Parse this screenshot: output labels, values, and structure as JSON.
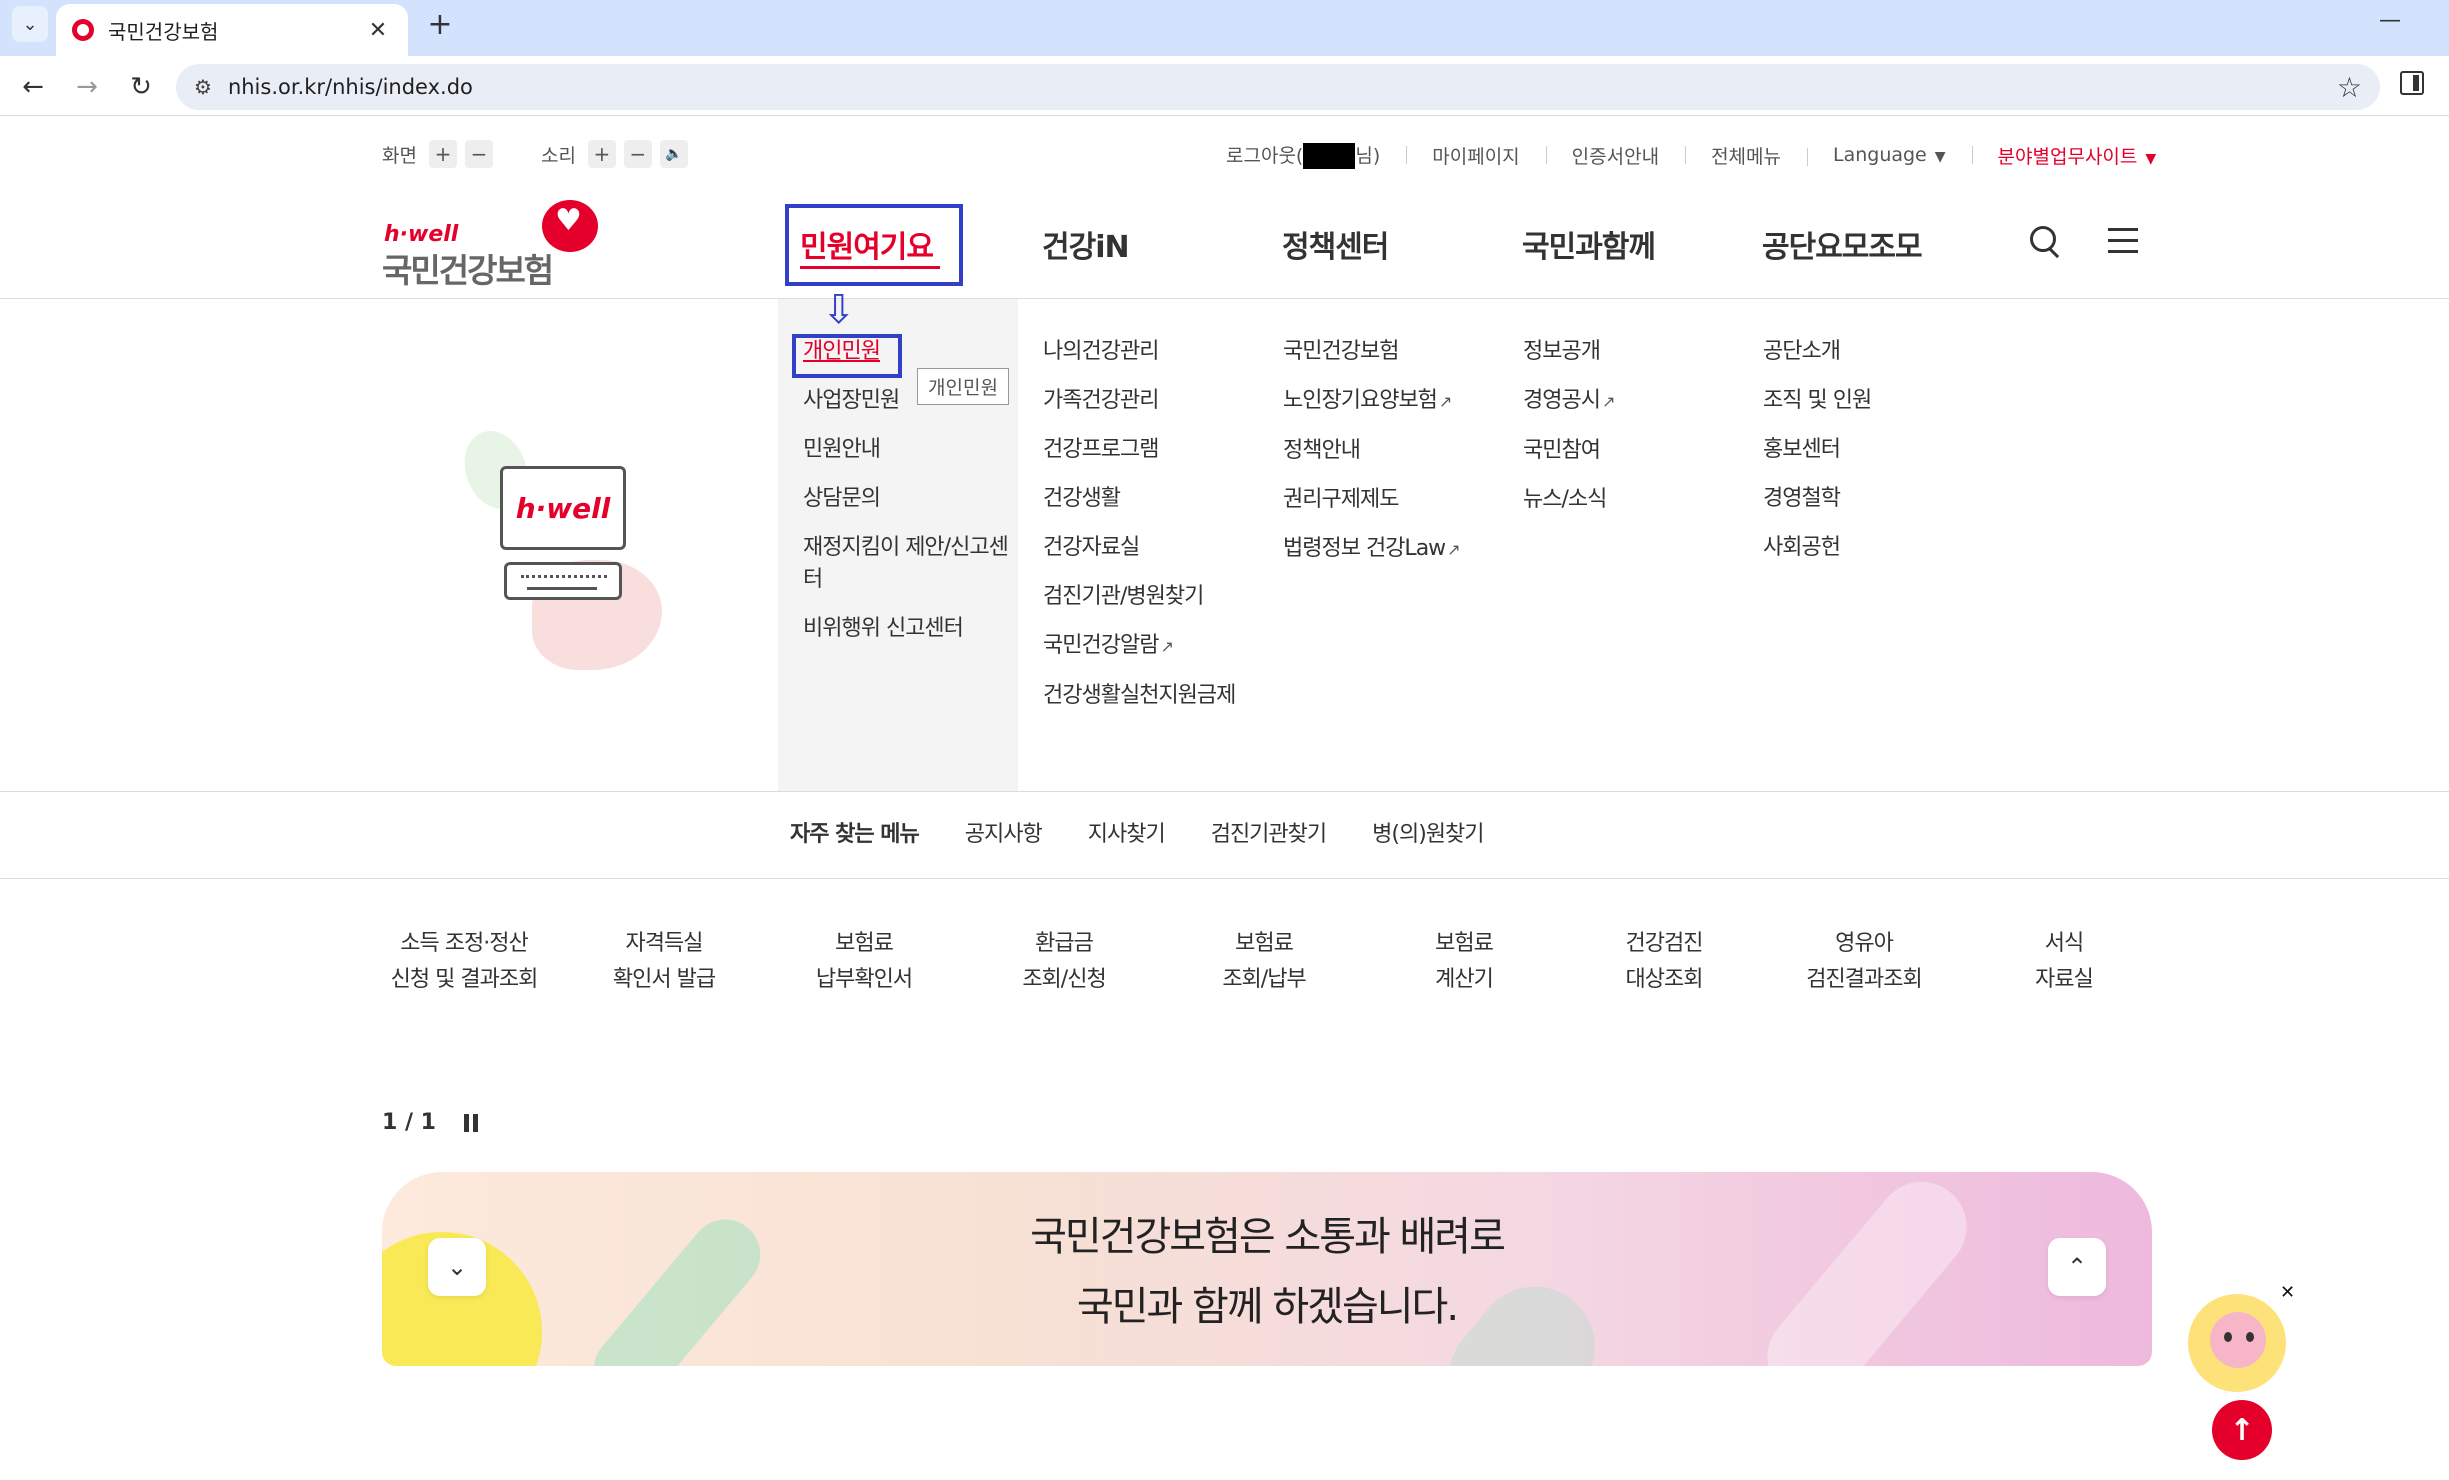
{
  "browser": {
    "tab_title": "국민건강보험",
    "url": "nhis.or.kr/nhis/index.do",
    "new_tab": "+",
    "close": "✕",
    "minimize": "—"
  },
  "util": {
    "screen_label": "화면",
    "sound_label": "소리",
    "plus": "+",
    "minus": "−",
    "speaker": "🔈",
    "logout_prefix": "로그아웃(",
    "logout_suffix": "님)",
    "mypage": "마이페이지",
    "cert": "인증서안내",
    "allmenu": "전체메뉴",
    "language": "Language",
    "field_sites": "분야별업무사이트",
    "caret": "▼"
  },
  "logo": {
    "hwell": "h·well",
    "name": "국민건강보험"
  },
  "gnb": [
    "민원여기요",
    "건강iN",
    "정책센터",
    "국민과함께",
    "공단요모조모"
  ],
  "submenu": {
    "col1": [
      "개인민원",
      "사업장민원",
      "민원안내",
      "상담문의",
      "재정지킴이 제안/신고센터",
      "비위행위 신고센터"
    ],
    "col2": [
      "나의건강관리",
      "가족건강관리",
      "건강프로그램",
      "건강생활",
      "건강자료실",
      "검진기관/병원찾기",
      "국민건강알람",
      "건강생활실천지원금제"
    ],
    "col3": [
      "국민건강보험",
      "노인장기요양보험",
      "정책안내",
      "권리구제제도",
      "법령정보 건강Law"
    ],
    "col4": [
      "정보공개",
      "경영공시",
      "국민참여",
      "뉴스/소식"
    ],
    "col5": [
      "공단소개",
      "조직 및 인원",
      "홍보센터",
      "경영철학",
      "사회공헌"
    ],
    "tooltip": "개인민원",
    "ext_icon": "↗"
  },
  "illustration": {
    "monitor_text": "h·well"
  },
  "freq": {
    "title": "자주 찾는 메뉴",
    "items": [
      "공지사항",
      "지사찾기",
      "검진기관찾기",
      "병(의)원찾기"
    ]
  },
  "services": [
    [
      "소득 조정·정산",
      "신청 및 결과조회"
    ],
    [
      "자격득실",
      "확인서 발급"
    ],
    [
      "보험료",
      "납부확인서"
    ],
    [
      "환급금",
      "조회/신청"
    ],
    [
      "보험료",
      "조회/납부"
    ],
    [
      "보험료",
      "계산기"
    ],
    [
      "건강검진",
      "대상조회"
    ],
    [
      "영유아",
      "검진결과조회"
    ],
    [
      "서식",
      "자료실"
    ]
  ],
  "slider": {
    "pager": "1 / 1",
    "line1": "국민건강보험은 소통과 배려로",
    "line2": "국민과 함께 하겠습니다.",
    "down": "⌄",
    "up": "⌃"
  },
  "floating": {
    "close": "✕",
    "top": "↑"
  },
  "colors": {
    "brand_red": "#e4002b",
    "highlight_blue": "#3140c6"
  }
}
